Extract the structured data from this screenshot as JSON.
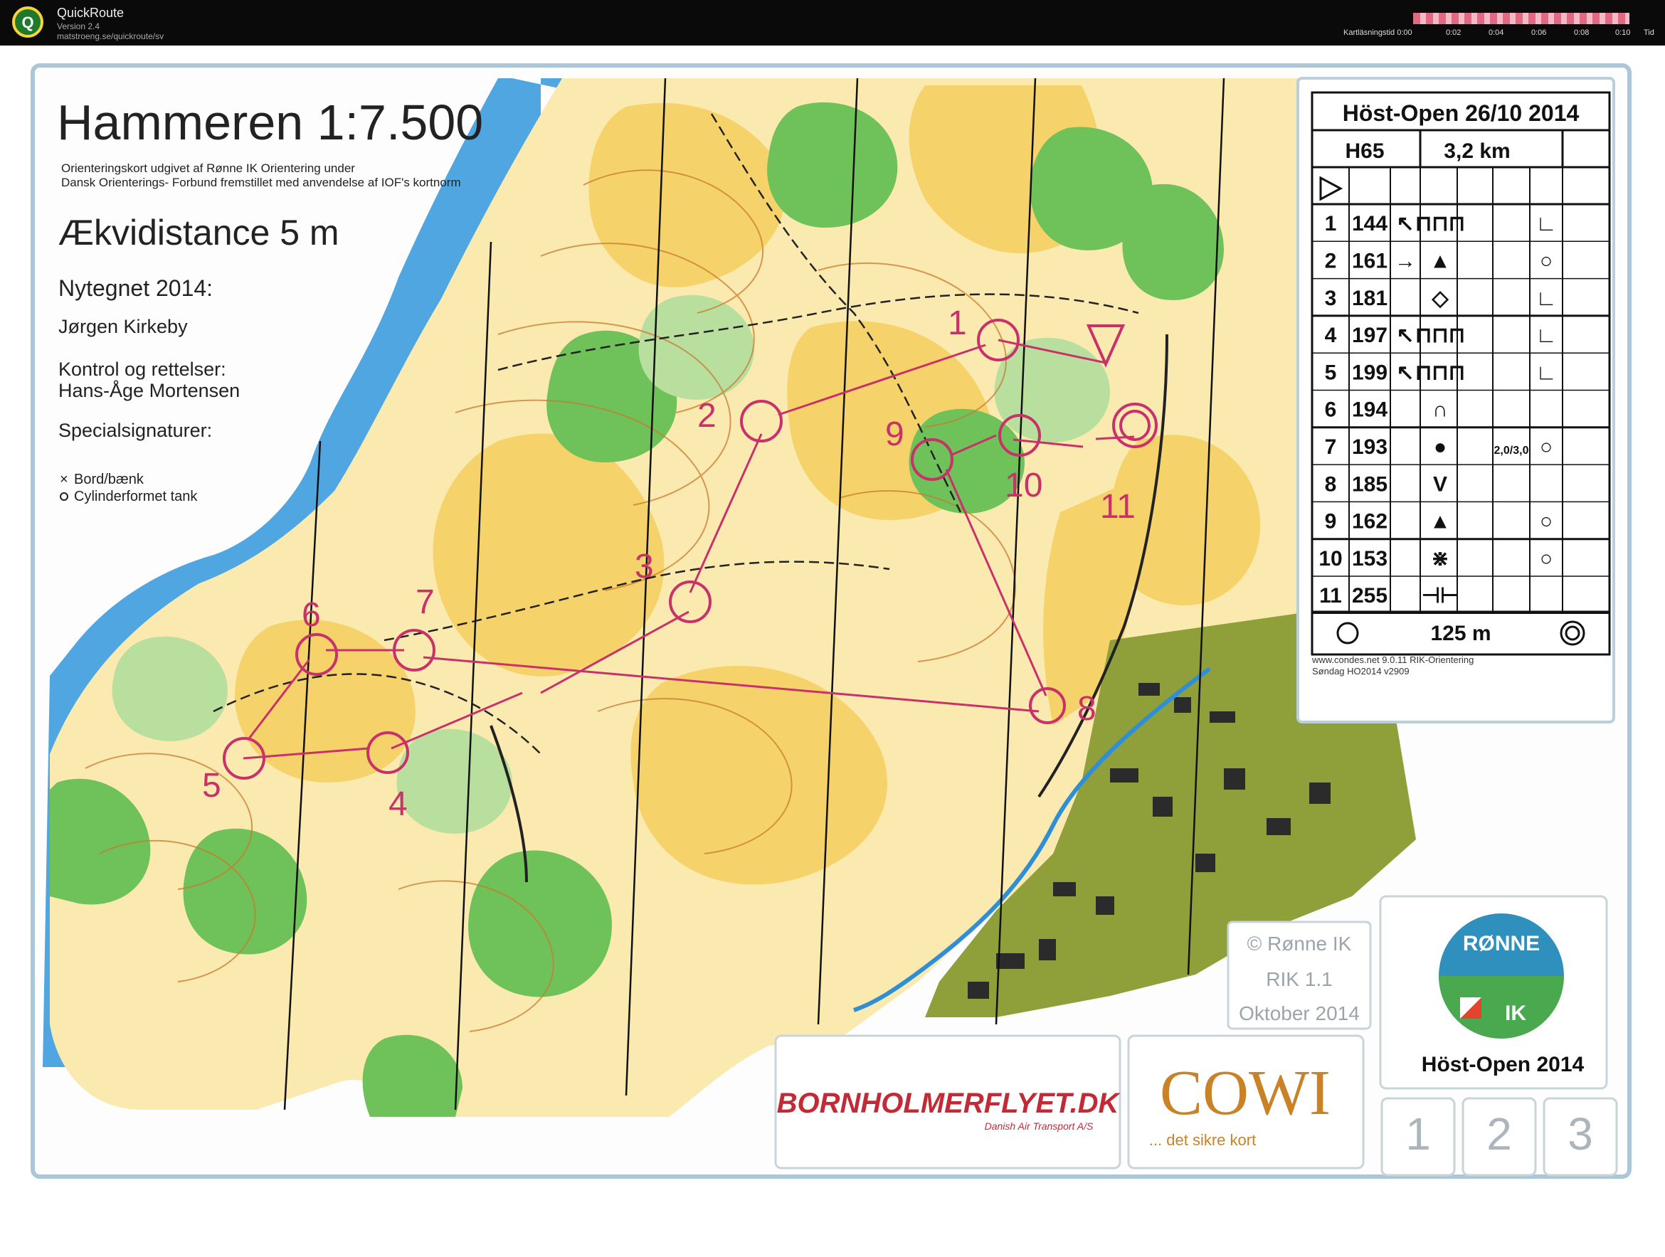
{
  "app": {
    "title": "QuickRoute",
    "version": "Version 2.4",
    "url": "matstroeng.se/quickroute/sv",
    "time_label": "Kartläsningstid 0:00",
    "ticks": [
      "0:02",
      "0:04",
      "0:06",
      "0:08",
      "0:10"
    ],
    "tid_label": "Tid"
  },
  "map": {
    "title": "Hammeren 1:7.500",
    "subtitle_line1": "Orienteringskort udgivet af Rønne IK Orientering under",
    "subtitle_line2": "Dansk Orienterings- Forbund fremstillet med anvendelse af IOF's kortnorm",
    "equidistance": "Ækvidistance 5 m",
    "redrawn": "Nytegnet 2014:",
    "author": "Jørgen Kirkeby",
    "control_label": "Kontrol og rettelser:",
    "controller": "Hans-Åge Mortensen",
    "special_label": "Specialsignaturer:",
    "special_items": [
      "Bord/bænk",
      "Cylinderformet tank"
    ],
    "copyright_lines": [
      "© Rønne IK",
      "RIK 1.1",
      "Oktober 2014"
    ],
    "sponsor1": "BORNHOLMERFLYET.DK",
    "sponsor1_sub": "Danish Air Transport A/S",
    "sponsor2": "COWI",
    "sponsor2_sub": "... det sikre kort",
    "event_logo_top": "RØNNE",
    "event_logo_bottom": "IK",
    "event_name": "Höst-Open 2014",
    "stage_boxes": [
      "1",
      "2",
      "3"
    ],
    "control_numbers_on_map": [
      "1",
      "2",
      "3",
      "4",
      "5",
      "6",
      "7",
      "8",
      "9",
      "10",
      "11"
    ]
  },
  "description_sheet": {
    "event": "Höst-Open 26/10 2014",
    "class": "H65",
    "length": "3,2 km",
    "controls": [
      {
        "n": "1",
        "code": "144",
        "dir": "↖",
        "feature": "⊓⊓⊓",
        "where": "∟"
      },
      {
        "n": "2",
        "code": "161",
        "dir": "→",
        "feature": "▲",
        "where": "○"
      },
      {
        "n": "3",
        "code": "181",
        "dir": "",
        "feature": "◇",
        "where": "∟"
      },
      {
        "n": "4",
        "code": "197",
        "dir": "↖",
        "feature": "⊓⊓⊓",
        "where": "∟"
      },
      {
        "n": "5",
        "code": "199",
        "dir": "↖",
        "feature": "⊓⊓⊓",
        "where": "∟"
      },
      {
        "n": "6",
        "code": "194",
        "dir": "",
        "feature": "∩",
        "where": ""
      },
      {
        "n": "7",
        "code": "193",
        "dir": "",
        "feature": "●",
        "size": "2,0/3,0",
        "where": "○"
      },
      {
        "n": "8",
        "code": "185",
        "dir": "",
        "feature": "V",
        "where": ""
      },
      {
        "n": "9",
        "code": "162",
        "dir": "",
        "feature": "▲",
        "where": "○"
      },
      {
        "n": "10",
        "code": "153",
        "dir": "",
        "feature": "⋇",
        "where": "○"
      },
      {
        "n": "11",
        "code": "255",
        "dir": "",
        "feature": "⊣⊢",
        "where": ""
      }
    ],
    "finish": "125 m",
    "footer1": "www.condes.net 9.0.11 RIK-Orientering",
    "footer2": "Søndag HO2014 v2909"
  },
  "colors": {
    "water": "#4fa6e0",
    "open_land": "#f6d36a",
    "rough_open": "#fbeab0",
    "forest_green": "#6fc15a",
    "light_green": "#b8df9e",
    "course": "#c8316a",
    "urban": "#8fa03a",
    "contour": "#c87b2e"
  }
}
